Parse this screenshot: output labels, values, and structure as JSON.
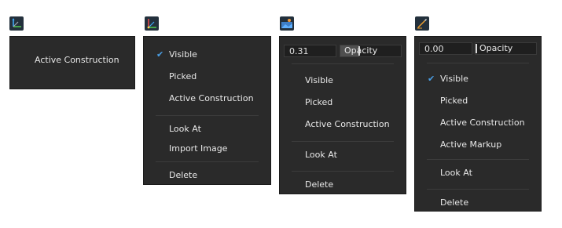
{
  "menu1": {
    "items": [
      "Active Construction"
    ]
  },
  "menu2": {
    "checked_index": 0,
    "group1": [
      "Visible",
      "Picked",
      "Active Construction"
    ],
    "group2": [
      "Look At",
      "Import Image"
    ],
    "group3": [
      "Delete"
    ]
  },
  "menu3": {
    "opacity_value": "0.31",
    "opacity_label": "Opacity",
    "opacity_fraction": 0.31,
    "group1": [
      "Visible",
      "Picked",
      "Active Construction"
    ],
    "group2": [
      "Look At"
    ],
    "group3": [
      "Delete"
    ]
  },
  "menu4": {
    "opacity_value": "0.00",
    "opacity_label": "Opacity",
    "opacity_fraction": 0.0,
    "checked_index": 0,
    "group1": [
      "Visible",
      "Picked",
      "Active Construction",
      "Active Markup"
    ],
    "group2": [
      "Look At"
    ],
    "group3": [
      "Delete"
    ]
  },
  "icons": [
    "axes-icon",
    "coordinate-frame-icon",
    "image-plane-icon",
    "markup-pen-icon"
  ],
  "colors": {
    "panel_bg": "#2a2a2a",
    "check": "#4a9fe6",
    "separator": "#3c3c3c"
  }
}
